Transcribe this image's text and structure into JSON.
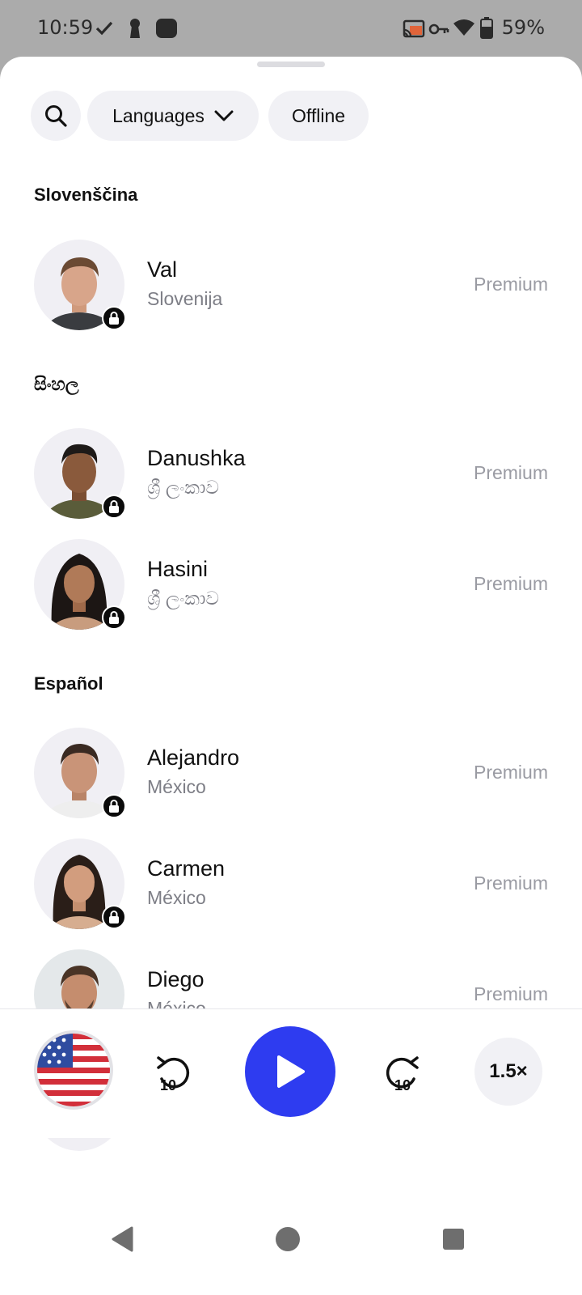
{
  "status_bar": {
    "time": "10:59",
    "battery": "59%"
  },
  "filters": {
    "languages_label": "Languages",
    "offline_label": "Offline"
  },
  "sections": [
    {
      "title": "Slovenščina",
      "voices": [
        {
          "name": "Val",
          "country": "Slovenija",
          "tier": "Premium"
        }
      ]
    },
    {
      "title": "සිංහල",
      "voices": [
        {
          "name": "Danushka",
          "country": "ශ්‍රී ලංකාව",
          "tier": "Premium"
        },
        {
          "name": "Hasini",
          "country": "ශ්‍රී ලංකාව",
          "tier": "Premium"
        }
      ]
    },
    {
      "title": "Español",
      "voices": [
        {
          "name": "Alejandro",
          "country": "México",
          "tier": "Premium"
        },
        {
          "name": "Carmen",
          "country": "México",
          "tier": "Premium"
        },
        {
          "name": "Diego",
          "country": "México",
          "tier": "Premium"
        }
      ]
    }
  ],
  "player": {
    "rewind_seconds": "10",
    "forward_seconds": "10",
    "speed": "1.5×"
  },
  "colors": {
    "accent": "#2e3cf0",
    "muted": "#9a9ba3"
  },
  "icons": [
    "search-icon",
    "chevron-down-icon",
    "lock-icon",
    "rewind-10-icon",
    "play-icon",
    "forward-10-icon",
    "us-flag-icon",
    "back-icon",
    "home-icon",
    "recents-icon"
  ]
}
